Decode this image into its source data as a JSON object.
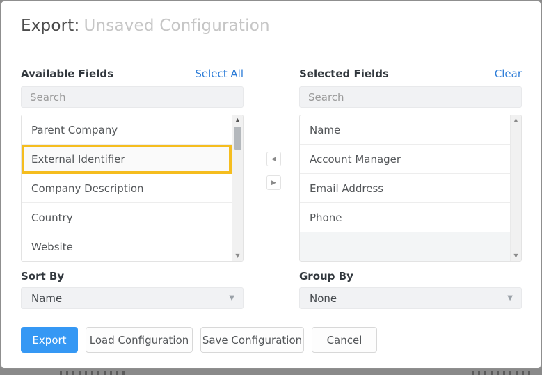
{
  "modal": {
    "title_prefix": "Export:",
    "title_value": "Unsaved Configuration"
  },
  "available": {
    "label": "Available Fields",
    "action": "Select All",
    "search_placeholder": "Search",
    "items": [
      "Parent Company",
      "External Identifier",
      "Company Description",
      "Country",
      "Website"
    ],
    "highlighted_item": "External Identifier"
  },
  "selected": {
    "label": "Selected Fields",
    "action": "Clear",
    "search_placeholder": "Search",
    "items": [
      "Name",
      "Account Manager",
      "Email Address",
      "Phone"
    ]
  },
  "transfer": {
    "move_left_icon": "◀",
    "move_right_icon": "▶"
  },
  "scrollbar_icons": {
    "up": "▲",
    "down": "▼"
  },
  "sort_by": {
    "label": "Sort By",
    "value": "Name"
  },
  "group_by": {
    "label": "Group By",
    "value": "None"
  },
  "dropdown_caret": "▼",
  "footer": {
    "export": "Export",
    "load": "Load Configuration",
    "save": "Save Configuration",
    "cancel": "Cancel"
  },
  "colors": {
    "accent_blue": "#3598f4",
    "link_blue": "#2f7ed8",
    "highlight_yellow": "#f5bd1f"
  }
}
